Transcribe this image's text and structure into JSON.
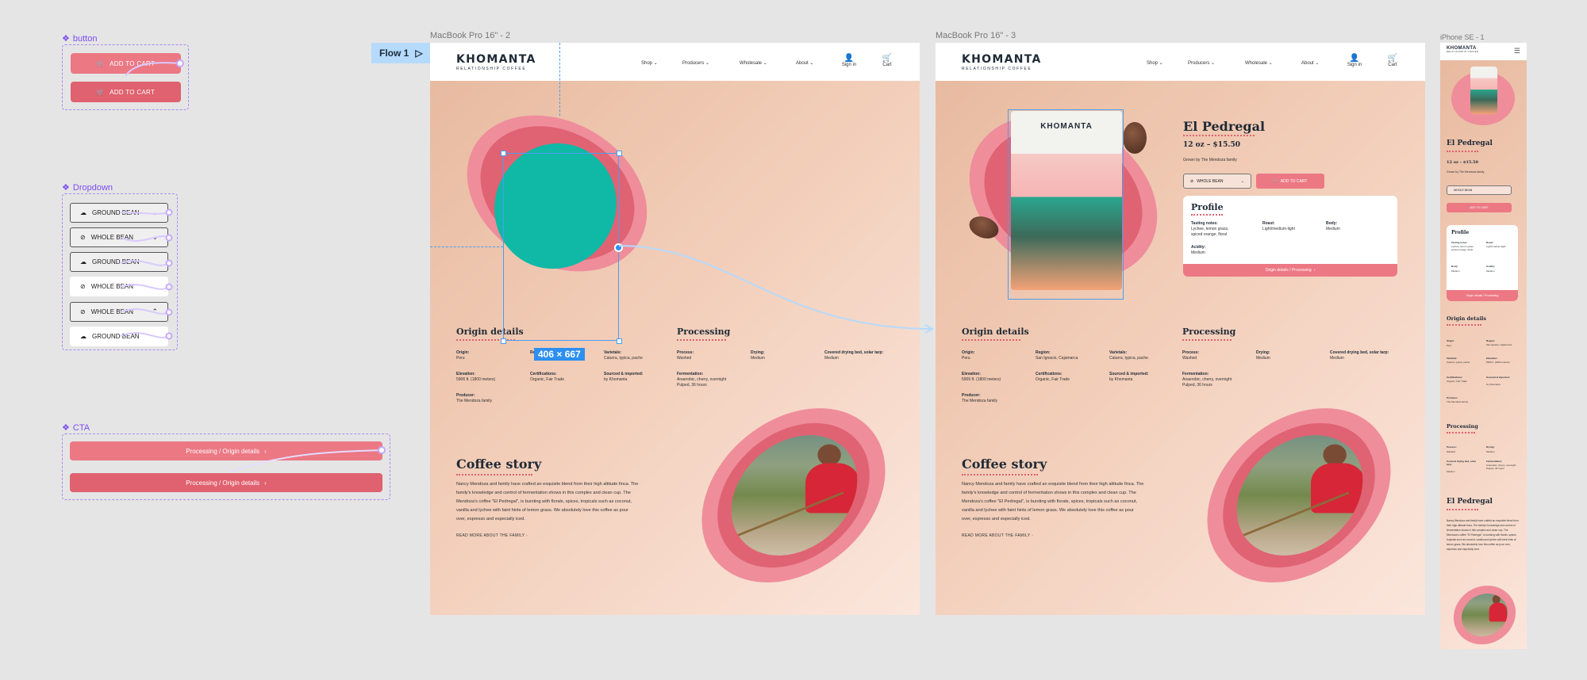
{
  "components": {
    "button": {
      "title": "button",
      "labels": [
        "ADD TO CART",
        "ADD TO CART"
      ]
    },
    "dropdown": {
      "title": "Dropdown",
      "items": [
        "GROUND BEAN",
        "WHOLE BEAN",
        "GROUND BEAN",
        "WHOLE BEAN",
        "WHOLE BEAN",
        "GROUND BEAN"
      ]
    },
    "cta": {
      "title": "CTA",
      "labels": [
        "Processing / Origin details",
        "Processing / Origin details"
      ]
    }
  },
  "canvas": {
    "flow_label": "Flow 1",
    "selection_dims": "406 × 667"
  },
  "frames": [
    {
      "label": "MacBook Pro 16\" - 2"
    },
    {
      "label": "MacBook Pro 16\" - 3"
    },
    {
      "label": "iPhone SE - 1"
    }
  ],
  "site": {
    "brand": "KHOMANTA",
    "tagline": "RELATIONSHIP COFFEE",
    "nav": [
      "Shop",
      "Producers",
      "Wholesale",
      "About"
    ],
    "sign_in": "Sign in",
    "cart": "Cart"
  },
  "product": {
    "name": "El Pedregal",
    "price": "12 oz – $15.50",
    "grown_by": "Grown by The Mendoza family",
    "grind_selected": "WHOLE BEAN",
    "add_to_cart": "ADD TO CART",
    "profile": {
      "title": "Profile",
      "tasting_label": "Tasting notes:",
      "tasting": "Lychee, lemon grass, spiced orange, floral",
      "roast_label": "Roast:",
      "roast": "Light/medium-light",
      "body_label": "Body:",
      "body": "Medium",
      "acidity_label": "Acidity:",
      "acidity": "Medium",
      "cta": "Origin details / Processing"
    }
  },
  "origin": {
    "title": "Origin details",
    "origin_label": "Origin:",
    "origin": "Peru",
    "region_label": "Region:",
    "region": "San Ignacio, Cajamarca",
    "varietals_label": "Varietals:",
    "varietals": "Caturra, typica, pache",
    "elevation_label": "Elevation:",
    "elevation": "5906 ft. (1800 meters)",
    "certifications_label": "Certifications:",
    "certifications": "Organic, Fair Trade",
    "sourced_label": "Sourced & imported:",
    "sourced": "by Khomanta",
    "producer_label": "Producer:",
    "producer": "The Mendoza family"
  },
  "processing": {
    "title": "Processing",
    "process_label": "Process:",
    "process": "Washed",
    "drying_label": "Drying:",
    "drying": "Medium",
    "covered_label": "Covered drying bed, solar tarp:",
    "covered": "Medium",
    "fermentation_label": "Fermentation:",
    "fermentation": "Anaerobic, cherry, overnight Pulped, 36 hours"
  },
  "story": {
    "title": "Coffee story",
    "paragraph": "Nancy Mendoza and family have crafted an exquisite blend from their high altitude finca. The family's knowledge and control of fermentation shows in this complex and clean cup. The Mendoza's coffee \"El Pedregal\", is bursting with florals, spices, tropicals such as coconut, vanilla and lychee with faint hints of lemon grass. We absolutely love this coffee as pour over, espresso and especially iced.",
    "link": "READ MORE ABOUT THE FAMILY"
  },
  "colors": {
    "canvas": "#e5e5e5",
    "accent": "#ec7884",
    "accent_dark": "#e0616f",
    "teal": "#10b8a6",
    "selection": "#2d8ff0",
    "component": "#7b4cf0"
  }
}
